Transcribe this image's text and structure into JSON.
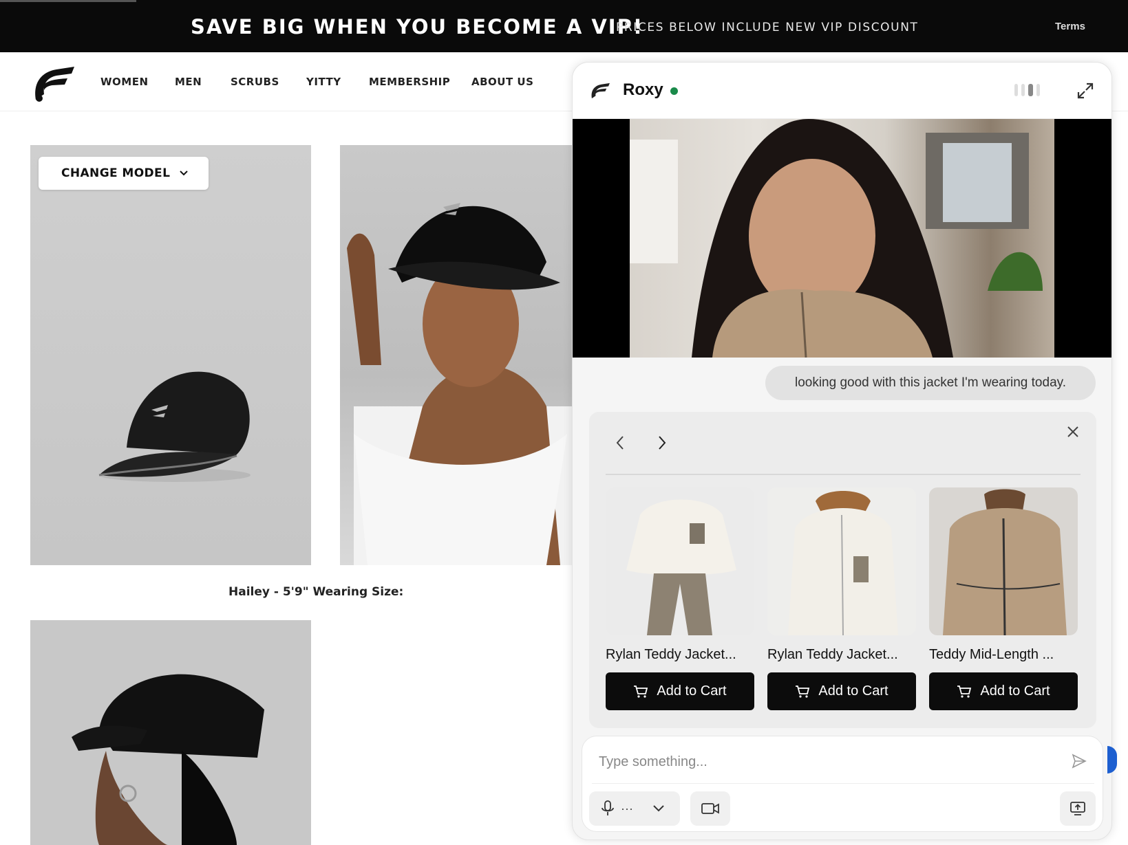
{
  "promo": {
    "headline": "SAVE BIG WHEN YOU BECOME A VIP!",
    "subline": "PRICES BELOW INCLUDE NEW VIP DISCOUNT",
    "terms": "Terms"
  },
  "nav": {
    "items": [
      "WOMEN",
      "MEN",
      "SCRUBS",
      "YITTY",
      "MEMBERSHIP",
      "ABOUT US"
    ]
  },
  "product_page": {
    "change_model_label": "CHANGE MODEL",
    "model_caption": "Hailey - 5'9\" Wearing Size:"
  },
  "chat": {
    "agent_name": "Roxy",
    "status_color": "#1a8a4a",
    "user_message": "looking good with this jacket I'm wearing today.",
    "products": [
      {
        "name": "Rylan Teddy Jacket...",
        "cta": "Add to Cart"
      },
      {
        "name": "Rylan Teddy Jacket...",
        "cta": "Add to Cart"
      },
      {
        "name": "Teddy Mid-Length ...",
        "cta": "Add to Cart"
      }
    ],
    "input_placeholder": "Type something...",
    "mic_more": "···"
  },
  "colors": {
    "banner_bg": "#0a0a0a",
    "button_bg": "#0c0c0c",
    "accent_blue": "#1d5fd0"
  }
}
